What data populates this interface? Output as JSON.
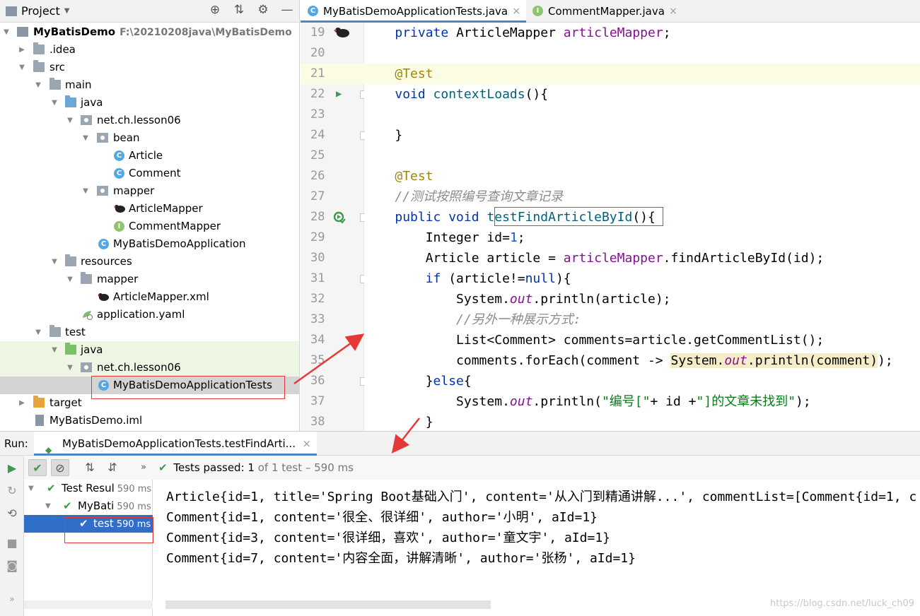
{
  "project_panel": {
    "title": "Project",
    "tree": [
      {
        "label": "MyBatisDemo",
        "path": "F:\\20210208java\\MyBatisDemo"
      },
      {
        "label": ".idea"
      },
      {
        "label": "src"
      },
      {
        "label": "main"
      },
      {
        "label": "java"
      },
      {
        "label": "net.ch.lesson06"
      },
      {
        "label": "bean"
      },
      {
        "label": "Article"
      },
      {
        "label": "Comment"
      },
      {
        "label": "mapper"
      },
      {
        "label": "ArticleMapper"
      },
      {
        "label": "CommentMapper"
      },
      {
        "label": "MyBatisDemoApplication"
      },
      {
        "label": "resources"
      },
      {
        "label": "mapper"
      },
      {
        "label": "ArticleMapper.xml"
      },
      {
        "label": "application.yaml"
      },
      {
        "label": "test"
      },
      {
        "label": "java"
      },
      {
        "label": "net.ch.lesson06"
      },
      {
        "label": "MyBatisDemoApplicationTests"
      },
      {
        "label": "target"
      },
      {
        "label": "MyBatisDemo.iml"
      }
    ]
  },
  "editor": {
    "tabs": [
      {
        "label": "MyBatisDemoApplicationTests.java"
      },
      {
        "label": "CommentMapper.java"
      }
    ],
    "line_numbers": [
      "19",
      "20",
      "21",
      "22",
      "23",
      "24",
      "25",
      "26",
      "27",
      "28",
      "29",
      "30",
      "31",
      "32",
      "33",
      "34",
      "35",
      "36",
      "37",
      "38"
    ],
    "code": {
      "l19_type": "ArticleMapper",
      "l19_field": "articleMapper",
      "annotation": "@Test",
      "l22_method": "contextLoads",
      "l27_comment": "//测试按照编号查询文章记录",
      "l28_method": "testFindArticleById",
      "l29_type": "Integer",
      "l29_var": "id",
      "l29_val": "1",
      "l30_text": "Article article = ",
      "l30_call": ".findArticleById(id);",
      "l31_cond": "(article!=",
      "l32_a": "System.",
      "l32_b": "out",
      "l32_c": ".println(article);",
      "l33_comment": "//另外一种展示方式:",
      "l34_text": "List<Comment> comments=article.getCommentList();",
      "l35_a": "comments.forEach(comment -> ",
      "l35_b": "System.",
      "l35_c": "out",
      "l35_d": ".println(comment)",
      "l35_e": ");",
      "l37_str1": "\"编号[\"",
      "l37_mid": "+ id +",
      "l37_str2": "\"]的文章未找到\""
    }
  },
  "run_panel": {
    "label": "Run:",
    "tab_label": "MyBatisDemoApplicationTests.testFindArti...",
    "status": {
      "prefix": "Tests passed:",
      "count": "1",
      "suffix": "of 1 test – 590 ms"
    },
    "test_tree": [
      {
        "name": "Test Resul",
        "time": "590 ms"
      },
      {
        "name": "MyBati",
        "time": "590 ms"
      },
      {
        "name": "test",
        "time": "590 ms"
      }
    ],
    "console": [
      "Article{id=1, title='Spring Boot基础入门', content='从入门到精通讲解...', commentList=[Comment{id=1, c",
      "Comment{id=1, content='很全、很详细', author='小明', aId=1}",
      "Comment{id=3, content='很详细，喜欢', author='童文宇', aId=1}",
      "Comment{id=7, content='内容全面，讲解清晰', author='张杨', aId=1}"
    ]
  },
  "watermark": "https://blog.csdn.net/luck_ch09",
  "colors": {
    "accent": "#4a88c7",
    "pass": "#3e9a4f",
    "annotation_box": "#e53935"
  }
}
